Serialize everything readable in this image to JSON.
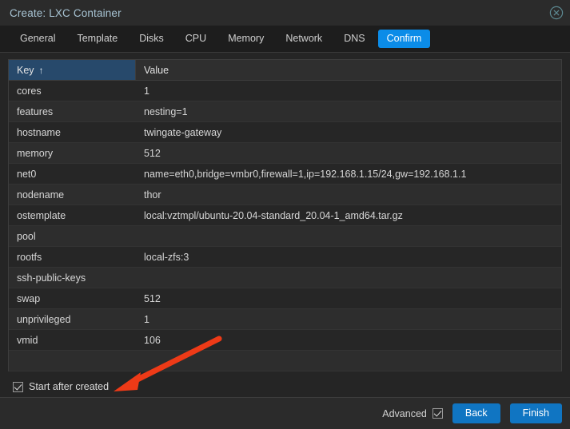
{
  "window": {
    "title": "Create: LXC Container",
    "close_icon": "close-circle-icon"
  },
  "tabs": [
    {
      "label": "General",
      "active": false
    },
    {
      "label": "Template",
      "active": false
    },
    {
      "label": "Disks",
      "active": false
    },
    {
      "label": "CPU",
      "active": false
    },
    {
      "label": "Memory",
      "active": false
    },
    {
      "label": "Network",
      "active": false
    },
    {
      "label": "DNS",
      "active": false
    },
    {
      "label": "Confirm",
      "active": true
    }
  ],
  "grid": {
    "columns": [
      {
        "label": "Key",
        "sorted": true,
        "sort_arrow": "↑"
      },
      {
        "label": "Value",
        "sorted": false,
        "sort_arrow": ""
      }
    ],
    "rows": [
      {
        "key": "cores",
        "value": "1"
      },
      {
        "key": "features",
        "value": "nesting=1"
      },
      {
        "key": "hostname",
        "value": "twingate-gateway"
      },
      {
        "key": "memory",
        "value": "512"
      },
      {
        "key": "net0",
        "value": "name=eth0,bridge=vmbr0,firewall=1,ip=192.168.1.15/24,gw=192.168.1.1"
      },
      {
        "key": "nodename",
        "value": "thor"
      },
      {
        "key": "ostemplate",
        "value": "local:vztmpl/ubuntu-20.04-standard_20.04-1_amd64.tar.gz"
      },
      {
        "key": "pool",
        "value": ""
      },
      {
        "key": "rootfs",
        "value": "local-zfs:3"
      },
      {
        "key": "ssh-public-keys",
        "value": ""
      },
      {
        "key": "swap",
        "value": "512"
      },
      {
        "key": "unprivileged",
        "value": "1"
      },
      {
        "key": "vmid",
        "value": "106"
      }
    ]
  },
  "start_after_created": {
    "label": "Start after created",
    "checked": true
  },
  "footer": {
    "advanced_label": "Advanced",
    "advanced_checked": true,
    "back_label": "Back",
    "finish_label": "Finish"
  },
  "annotation": {
    "type": "arrow",
    "color": "#ee3a17",
    "points_to": "start-after-created-checkbox"
  },
  "colors": {
    "accent_blue": "#0b8ce8",
    "button_blue": "#1075c2",
    "header_key_blue": "#27496b",
    "title_text": "#a8c4d4",
    "annotation_red": "#ee3a17"
  }
}
